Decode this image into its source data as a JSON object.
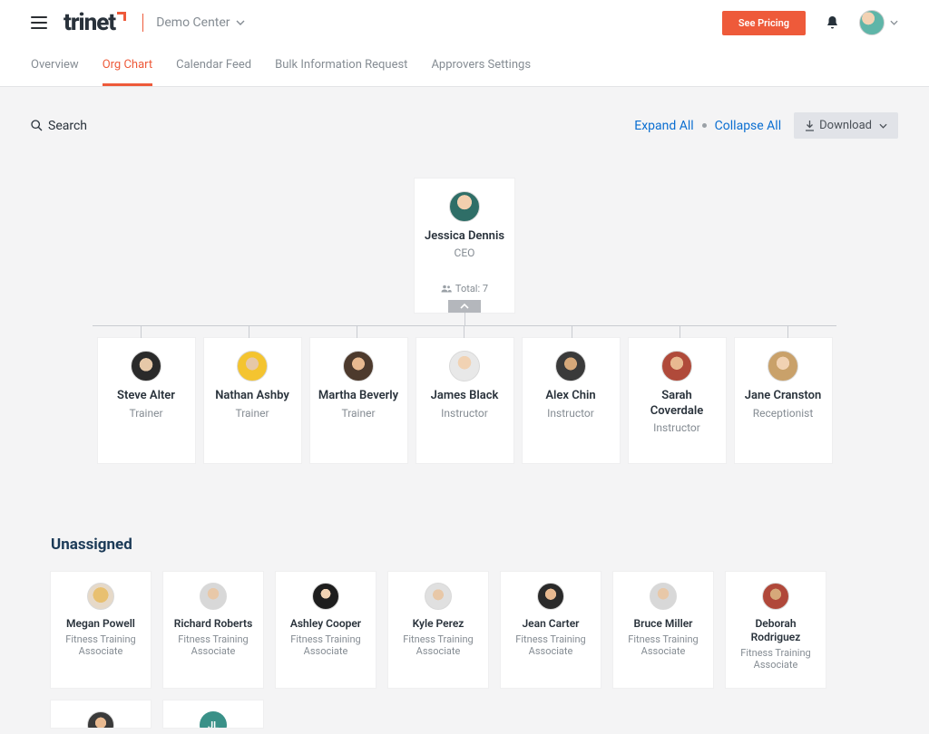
{
  "header": {
    "brand": "trinet",
    "workspace": "Demo Center",
    "see_pricing": "See Pricing"
  },
  "tabs": [
    {
      "label": "Overview",
      "active": false
    },
    {
      "label": "Org Chart",
      "active": true
    },
    {
      "label": "Calendar Feed",
      "active": false
    },
    {
      "label": "Bulk Information Request",
      "active": false
    },
    {
      "label": "Approvers Settings",
      "active": false
    }
  ],
  "controls": {
    "search_label": "Search",
    "expand_all": "Expand All",
    "collapse_all": "Collapse All",
    "download": "Download"
  },
  "org": {
    "root": {
      "name": "Jessica Dennis",
      "role": "CEO",
      "total_label": "Total: 7",
      "avatar": "av-jessica"
    },
    "children": [
      {
        "name": "Steve Alter",
        "role": "Trainer",
        "avatar": "av-steve"
      },
      {
        "name": "Nathan Ashby",
        "role": "Trainer",
        "avatar": "av-nathan"
      },
      {
        "name": "Martha Beverly",
        "role": "Trainer",
        "avatar": "av-martha"
      },
      {
        "name": "James Black",
        "role": "Instructor",
        "avatar": "av-james"
      },
      {
        "name": "Alex Chin",
        "role": "Instructor",
        "avatar": "av-alex"
      },
      {
        "name": "Sarah Coverdale",
        "role": "Instructor",
        "avatar": "av-sarah"
      },
      {
        "name": "Jane Cranston",
        "role": "Receptionist",
        "avatar": "av-jane"
      }
    ]
  },
  "unassigned": {
    "heading": "Unassigned",
    "people": [
      {
        "name": "Megan Powell",
        "role": "Fitness Training Associate",
        "avatar": "av-megan"
      },
      {
        "name": "Richard Roberts",
        "role": "Fitness Training Associate",
        "avatar": "av-richard"
      },
      {
        "name": "Ashley Cooper",
        "role": "Fitness Training Associate",
        "avatar": "av-ashley"
      },
      {
        "name": "Kyle Perez",
        "role": "Fitness Training Associate",
        "avatar": "av-kyle"
      },
      {
        "name": "Jean Carter",
        "role": "Fitness Training Associate",
        "avatar": "av-jean"
      },
      {
        "name": "Bruce Miller",
        "role": "Fitness Training Associate",
        "avatar": "av-bruce"
      },
      {
        "name": "Deborah Rodriguez",
        "role": "Fitness Training Associate",
        "avatar": "av-deborah"
      }
    ],
    "overflow": [
      {
        "avatar": "av-extra1"
      },
      {
        "initials": "JL"
      }
    ]
  }
}
